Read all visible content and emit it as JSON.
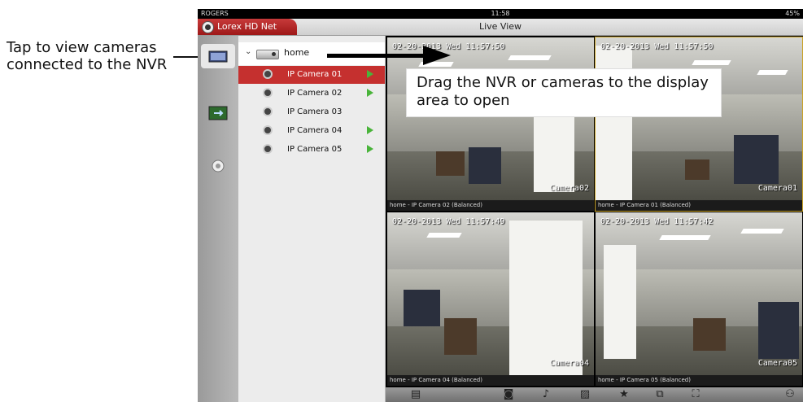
{
  "callouts": {
    "left": "Tap to view cameras connected to the NVR",
    "right": "Drag the NVR or cameras to the display area to open"
  },
  "status_bar": {
    "carrier": "ROGERS",
    "time": "11:58",
    "battery": "45%"
  },
  "app": {
    "name": "Lorex HD Net",
    "view_title": "Live View"
  },
  "sidebar": {
    "items": [
      {
        "icon": "device-list-icon",
        "active": true
      },
      {
        "icon": "playback-icon",
        "active": false
      },
      {
        "icon": "settings-icon",
        "active": false
      }
    ]
  },
  "device_tree": {
    "root": {
      "label": "home",
      "icon": "nvr-icon",
      "expanded": true
    },
    "cameras": [
      {
        "label": "IP Camera 01",
        "selected": true,
        "has_play": true
      },
      {
        "label": "IP Camera 02",
        "selected": false,
        "has_play": true
      },
      {
        "label": "IP Camera 03",
        "selected": false,
        "has_play": false
      },
      {
        "label": "IP Camera 04",
        "selected": false,
        "has_play": true
      },
      {
        "label": "IP Camera 05",
        "selected": false,
        "has_play": true
      }
    ]
  },
  "tiles": [
    {
      "osd": "02-20-2013 Wed 11:57:50",
      "cam": "Camera02",
      "caption": "home - IP Camera 02 (Balanced)"
    },
    {
      "osd": "02-20-2013 Wed 11:57:50",
      "cam": "Camera01",
      "caption": "home - IP Camera 01 (Balanced)"
    },
    {
      "osd": "02-20-2013 Wed 11:57:49",
      "cam": "Camera04",
      "caption": "home - IP Camera 04 (Balanced)"
    },
    {
      "osd": "02-20-2013 Wed 11:57:42",
      "cam": "Camera05",
      "caption": "home - IP Camera 05 (Balanced)"
    }
  ],
  "toolbar": {
    "icons": [
      "layout-icon",
      "snapshot-icon",
      "microphone-icon",
      "record-icon",
      "favorite-star-icon",
      "remote-view-icon",
      "fullscreen-icon",
      "ptz-icon"
    ]
  },
  "colors": {
    "accent_red": "#c5302f",
    "play_green": "#49b43a",
    "selected_border": "#c9a227"
  }
}
